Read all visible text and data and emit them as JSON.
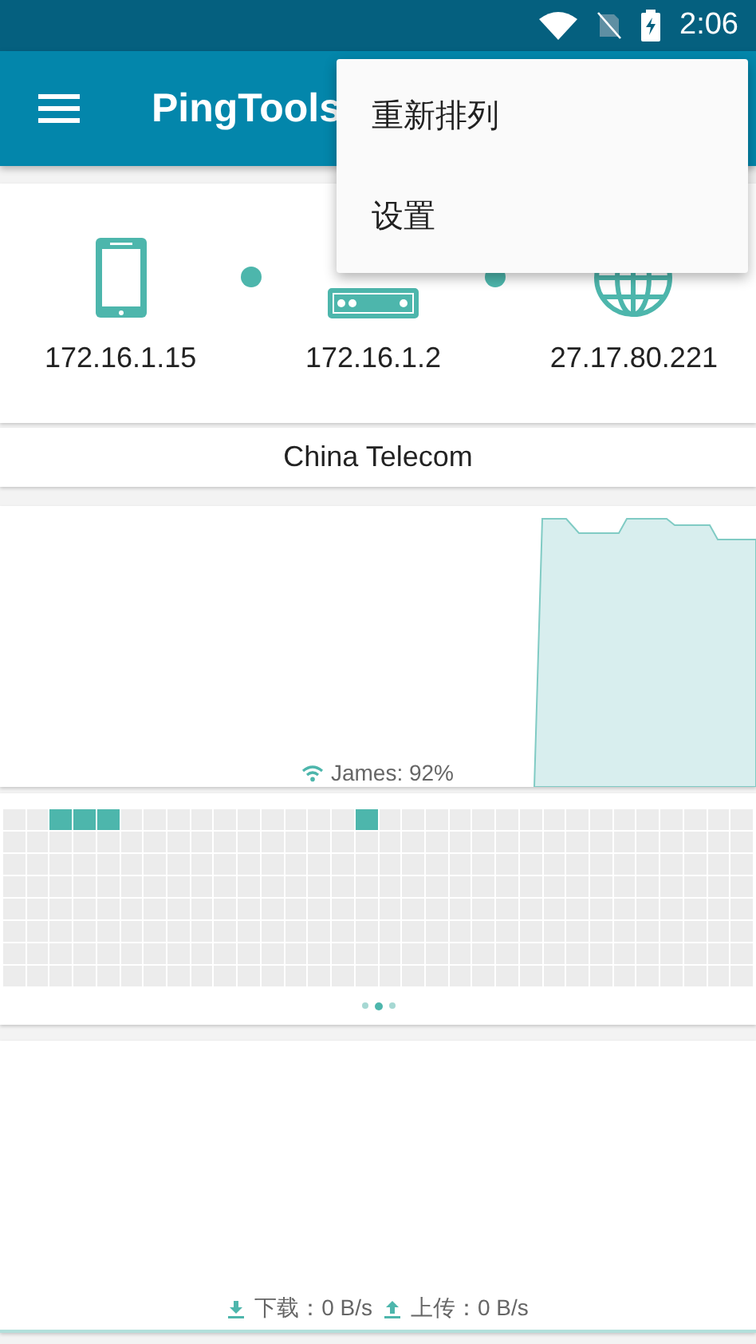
{
  "status_bar": {
    "time": "2:06"
  },
  "app_bar": {
    "title": "PingTools"
  },
  "menu": {
    "items": [
      {
        "label": "重新排列"
      },
      {
        "label": "设置"
      }
    ]
  },
  "route": [
    {
      "kind": "phone",
      "address": "172.16.1.15"
    },
    {
      "kind": "router",
      "address": "172.16.1.2"
    },
    {
      "kind": "globe",
      "address": "27.17.80.221"
    }
  ],
  "provider": "China Telecom",
  "chart": {
    "network": "James: 92%"
  },
  "ping_grid": {
    "rows": [
      [
        false,
        false,
        true,
        true,
        true,
        false,
        false,
        false,
        false,
        false,
        false,
        false,
        false,
        false,
        false,
        true,
        false,
        false,
        false,
        false,
        false,
        false,
        false,
        false,
        false,
        false,
        false,
        false,
        false,
        false,
        false,
        false
      ],
      [
        false,
        false,
        false,
        false,
        false,
        false,
        false,
        false,
        false,
        false,
        false,
        false,
        false,
        false,
        false,
        false,
        false,
        false,
        false,
        false,
        false,
        false,
        false,
        false,
        false,
        false,
        false,
        false,
        false,
        false,
        false,
        false
      ],
      [
        false,
        false,
        false,
        false,
        false,
        false,
        false,
        false,
        false,
        false,
        false,
        false,
        false,
        false,
        false,
        false,
        false,
        false,
        false,
        false,
        false,
        false,
        false,
        false,
        false,
        false,
        false,
        false,
        false,
        false,
        false,
        false
      ],
      [
        false,
        false,
        false,
        false,
        false,
        false,
        false,
        false,
        false,
        false,
        false,
        false,
        false,
        false,
        false,
        false,
        false,
        false,
        false,
        false,
        false,
        false,
        false,
        false,
        false,
        false,
        false,
        false,
        false,
        false,
        false,
        false
      ],
      [
        false,
        false,
        false,
        false,
        false,
        false,
        false,
        false,
        false,
        false,
        false,
        false,
        false,
        false,
        false,
        false,
        false,
        false,
        false,
        false,
        false,
        false,
        false,
        false,
        false,
        false,
        false,
        false,
        false,
        false,
        false,
        false
      ],
      [
        false,
        false,
        false,
        false,
        false,
        false,
        false,
        false,
        false,
        false,
        false,
        false,
        false,
        false,
        false,
        false,
        false,
        false,
        false,
        false,
        false,
        false,
        false,
        false,
        false,
        false,
        false,
        false,
        false,
        false,
        false,
        false
      ],
      [
        false,
        false,
        false,
        false,
        false,
        false,
        false,
        false,
        false,
        false,
        false,
        false,
        false,
        false,
        false,
        false,
        false,
        false,
        false,
        false,
        false,
        false,
        false,
        false,
        false,
        false,
        false,
        false,
        false,
        false,
        false,
        false
      ],
      [
        false,
        false,
        false,
        false,
        false,
        false,
        false,
        false,
        false,
        false,
        false,
        false,
        false,
        false,
        false,
        false,
        false,
        false,
        false,
        false,
        false,
        false,
        false,
        false,
        false,
        false,
        false,
        false,
        false,
        false,
        false,
        false
      ]
    ]
  },
  "pager": [
    {
      "selected": false
    },
    {
      "selected": true
    },
    {
      "selected": false
    }
  ],
  "traffic": {
    "download": "下载：0 B/s",
    "upload": "上传：0 B/s"
  }
}
